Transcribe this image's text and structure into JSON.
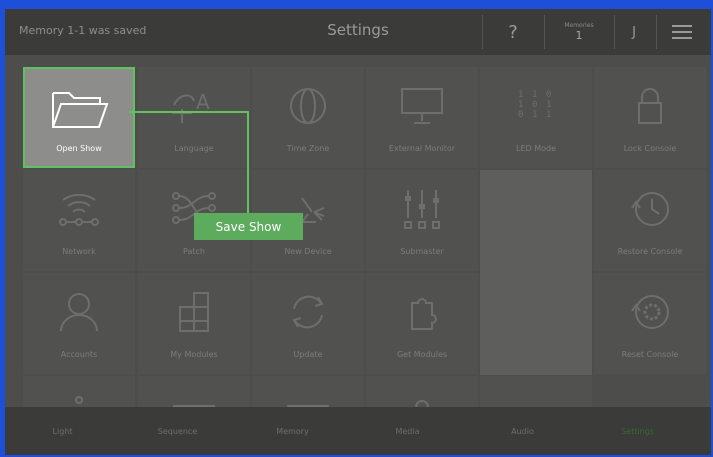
{
  "topbar": {
    "status": "Memory 1-1 was saved",
    "title": "Settings",
    "help_label": "?",
    "memories_label": "Memories",
    "memories_value": "1",
    "user_initial": "J"
  },
  "tiles": [
    {
      "label": "Open Show"
    },
    {
      "label": "Language"
    },
    {
      "label": "Time Zone"
    },
    {
      "label": "External Monitor"
    },
    {
      "label": "LED Mode"
    },
    {
      "label": "Lock Console"
    },
    {
      "label": "Network"
    },
    {
      "label": "Patch"
    },
    {
      "label": "New Device"
    },
    {
      "label": "Submaster"
    },
    {
      "label": "Restore Console"
    },
    {
      "label": "Accounts"
    },
    {
      "label": "My Modules"
    },
    {
      "label": "Update"
    },
    {
      "label": "Get Modules"
    },
    {
      "label": "Reset Console"
    }
  ],
  "save_show_label": "Save Show",
  "bottom_tabs": [
    {
      "label": "Light"
    },
    {
      "label": "Sequence"
    },
    {
      "label": "Memory"
    },
    {
      "label": "Media"
    },
    {
      "label": "Audio"
    },
    {
      "label": "Settings",
      "color": "#2f6e2f"
    }
  ],
  "colors": {
    "accent": "#5ec35e",
    "button": "#5dab5d"
  }
}
